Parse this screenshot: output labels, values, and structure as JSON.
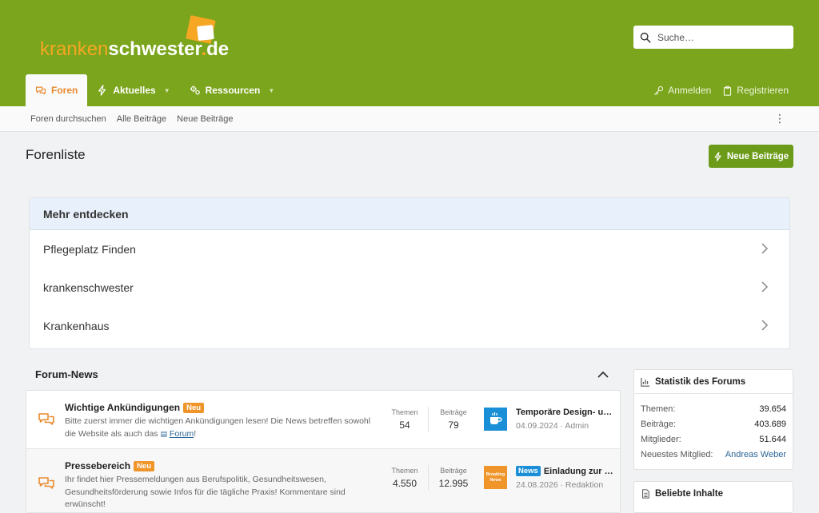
{
  "logo": {
    "part1": "kranken",
    "part2": "schwester",
    "part3": ".",
    "part4": "de"
  },
  "search": {
    "placeholder": "Suche…"
  },
  "nav": {
    "tabs": [
      {
        "label": "Foren",
        "icon": "comments-icon",
        "active": true
      },
      {
        "label": "Aktuelles",
        "icon": "bolt-icon",
        "dropdown": true
      },
      {
        "label": "Ressourcen",
        "icon": "gears-icon",
        "dropdown": true
      }
    ],
    "login": "Anmelden",
    "register": "Registrieren"
  },
  "subnav": {
    "items": [
      "Foren durchsuchen",
      "Alle Beiträge",
      "Neue Beiträge"
    ]
  },
  "page": {
    "title": "Forenliste",
    "new_posts_button": "Neue Beiträge"
  },
  "discover": {
    "title": "Mehr entdecken",
    "items": [
      "Pflegeplatz Finden",
      "krankenschwester",
      "Krankenhaus"
    ]
  },
  "forum_news": {
    "title": "Forum-News",
    "forums": [
      {
        "title": "Wichtige Ankündigungen",
        "badge": "Neu",
        "desc": "Bitte zuerst immer die wichtigen Ankündigungen lesen! Die News betreffen sowohl die Website als auch das",
        "desc_link": "Forum",
        "desc_end": "!",
        "themen_label": "Themen",
        "themen": "54",
        "beitraege_label": "Beiträge",
        "beitraege": "79",
        "latest_title": "Temporäre Design- u…",
        "latest_date": "04.09.2024",
        "latest_sep": "·",
        "latest_user": "Admin"
      },
      {
        "title": "Pressebereich",
        "badge": "Neu",
        "desc": "Ihr findet hier Pressemeldungen aus Berufspolitik, Gesundheitswesen, Gesundheitsförderung sowie Infos für die tägliche Praxis! Kommentare sind erwünscht!",
        "themen_label": "Themen",
        "themen": "4.550",
        "beitraege_label": "Beiträge",
        "beitraege": "12.995",
        "latest_prefix": "News",
        "latest_title": "Einladung zur …",
        "latest_date": "24.08.2026",
        "latest_sep": "·",
        "latest_user": "Redaktion",
        "latest_icon_text": "Breaking News"
      }
    ]
  },
  "stats": {
    "title": "Statistik des Forums",
    "rows": [
      {
        "label": "Themen:",
        "value": "39.654"
      },
      {
        "label": "Beiträge:",
        "value": "403.689"
      },
      {
        "label": "Mitglieder:",
        "value": "51.644"
      },
      {
        "label": "Neuestes Mitglied:",
        "value": "Andreas Weber"
      }
    ]
  },
  "popular": {
    "title": "Beliebte Inhalte"
  },
  "colors": {
    "brand_green": "#7aa51c",
    "accent_orange": "#f5a623",
    "link_blue": "#2a6496"
  }
}
